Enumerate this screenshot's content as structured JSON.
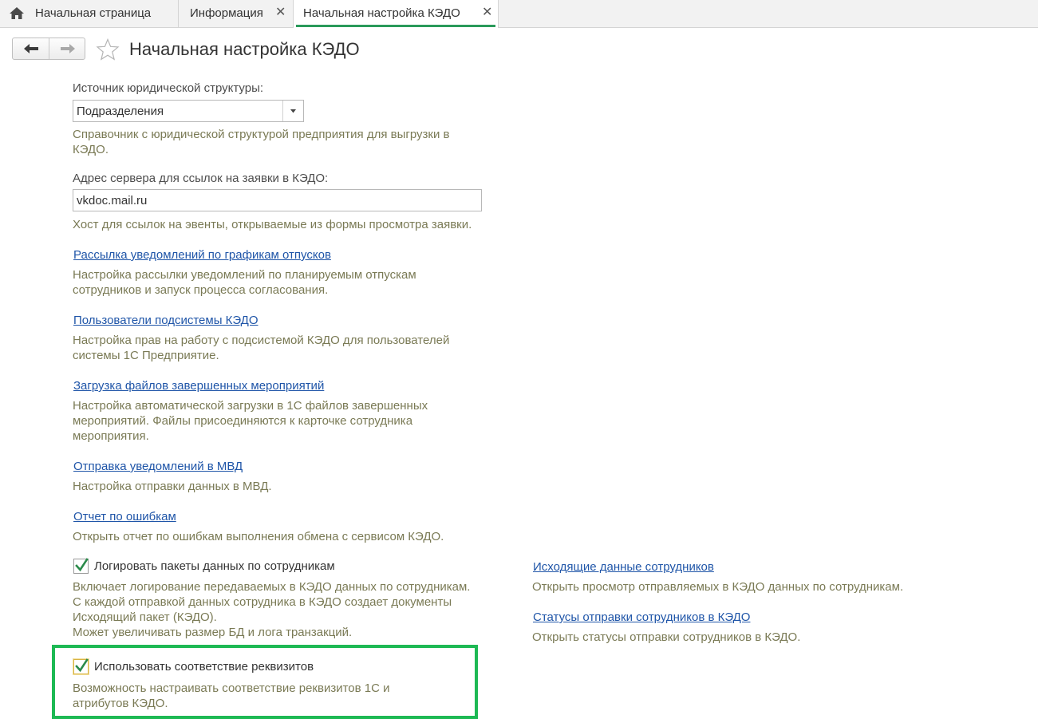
{
  "tabs": {
    "home_label": "Начальная страница",
    "info_label": "Информация",
    "active_label": "Начальная настройка КЭДО",
    "close_glyph": "✕"
  },
  "header": {
    "title": "Начальная настройка КЭДО"
  },
  "form": {
    "source_label": "Источник юридической структуры:",
    "source_value": "Подразделения",
    "source_hint_1": "Справочник с юридической структурой предприятия для выгрузки в",
    "source_hint_2": "КЭДО.",
    "server_label": "Адрес сервера для ссылок на заявки в КЭДО:",
    "server_value": "vkdoc.mail.ru",
    "server_hint": "Хост для ссылок на эвенты, открываемые из формы просмотра заявки."
  },
  "links": [
    {
      "label": "Рассылка уведомлений по графикам отпусков",
      "hint": [
        "Настройка рассылки уведомлений по планируемым отпускам",
        "сотрудников и запуск процесса согласования."
      ]
    },
    {
      "label": "Пользователи подсистемы КЭДО",
      "hint": [
        "Настройка прав на работу с подсистемой КЭДО для пользователей",
        "системы 1С Предприятие."
      ]
    },
    {
      "label": "Загрузка файлов завершенных мероприятий",
      "hint": [
        "Настройка автоматической загрузки в 1С файлов завершенных",
        "мероприятий. Файлы присоединяются к карточке сотрудника",
        "мероприятия."
      ]
    },
    {
      "label": "Отправка уведомлений в МВД",
      "hint": [
        "Настройка отправки данных в МВД."
      ]
    },
    {
      "label": "Отчет по ошибкам",
      "hint": [
        "Открыть отчет по ошибкам выполнения обмена с сервисом КЭДО."
      ]
    }
  ],
  "options": {
    "log_label": "Логировать пакеты данных по сотрудникам",
    "log_checked": true,
    "log_hint": [
      "Включает логирование передаваемых в КЭДО данных по сотрудникам.",
      "С каждой отправкой данных сотрудника в КЭДО создает документы",
      "Исходящий пакет (КЭДО).",
      "Может увеличивать размер БД и лога транзакций."
    ],
    "mapping_label": "Использовать соответствие реквизитов",
    "mapping_checked": true,
    "mapping_hint": [
      "Возможность настраивать соответствие реквизитов 1С и",
      "атрибутов КЭДО."
    ]
  },
  "right_links": [
    {
      "label": "Исходящие данные сотрудников",
      "hint": "Открыть просмотр отправляемых в КЭДО данных по сотрудникам."
    },
    {
      "label": "Статусы отправки сотрудников в КЭДО",
      "hint": "Открыть статусы отправки сотрудников в КЭДО."
    }
  ],
  "colors": {
    "link": "#1f55a8",
    "hint": "#7a7a55",
    "active_tab_underline": "#2a9a5a",
    "checkmark": "#2a8a4a",
    "highlight_frame": "#1db954"
  }
}
